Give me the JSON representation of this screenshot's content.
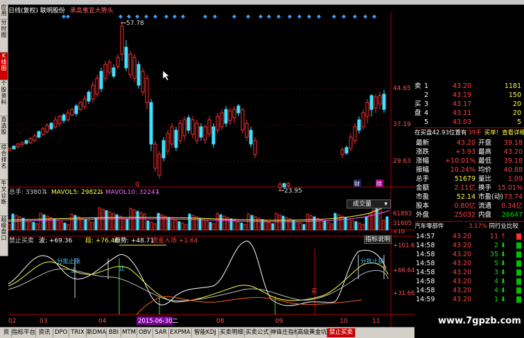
{
  "header": {
    "chart_label": "日线(复权)",
    "stock_name": "联明股份",
    "signal_text": "承高事宜大势头"
  },
  "side_tabs": [
    "应用",
    "分时图",
    "K线图",
    "个股资料",
    "自选股",
    "综合排名",
    "牛叉诊断",
    "超级盘口"
  ],
  "price_chart": {
    "price_axis": [
      "44.65",
      "37.19",
      "29.63"
    ],
    "high_label": "57.78",
    "low_label": "23.95",
    "marks": [
      "q",
      "财",
      "除"
    ],
    "up_color": "#ff3030",
    "down_color": "#40e0ff"
  },
  "volume_panel": {
    "total_hands_label": "总手: 33807",
    "mavol5_label": "MAVOL5: 29822",
    "mavol10_label": "MAVOL10: 32247",
    "selector": "成交量",
    "axis": [
      "61893",
      "31605"
    ],
    "axis_unit": "×10"
  },
  "indicator_panel": {
    "name": "禁止买卖",
    "wave": "波: +69.36",
    "segment": "段: +76.46",
    "trend": "趋势: +48.71",
    "fund": "资金入场 +1.64",
    "help": "指标说明",
    "axis": [
      "+101.6",
      "+66.64",
      "+31.66"
    ],
    "annotations": [
      "分批止涨",
      "止",
      "止",
      "分批止损",
      "买"
    ]
  },
  "x_axis": [
    "02",
    "03",
    "04",
    "2015-06-30二",
    "08",
    "09",
    "10",
    "11"
  ],
  "quote": {
    "order_book": [
      {
        "side": "卖",
        "level": "1",
        "price": "43.20",
        "vol": "1181"
      },
      {
        "side": "",
        "level": "2",
        "price": "43.19",
        "vol": "150"
      },
      {
        "side": "买",
        "level": "3",
        "price": "43.17",
        "vol": "20"
      },
      {
        "side": "盘",
        "level": "4",
        "price": "43.11",
        "vol": "20"
      },
      {
        "side": "",
        "level": "5",
        "price": "43.03",
        "vol": "5"
      }
    ],
    "bid_info": "在买盘42.93位置有",
    "bid_count": "39手",
    "bid_link": "买单！查看详细",
    "stats": [
      [
        "最新",
        "43.20",
        "开盘",
        "39.18"
      ],
      [
        "涨跌",
        "+3.93",
        "最高",
        "43.20"
      ],
      [
        "涨幅",
        "+10.01%",
        "最低",
        "39.18"
      ],
      [
        "振幅",
        "10.24%",
        "均价",
        "40.88"
      ],
      [
        "总手",
        "51679",
        "量比",
        "1.09"
      ],
      [
        "金额",
        "2.11亿",
        "换手",
        "15.01%"
      ],
      [
        "市盈",
        "52.14",
        "市盈(动)",
        "73.74"
      ],
      [
        "股本",
        "0.80亿",
        "流通",
        "0.34亿"
      ],
      [
        "外盘",
        "25032",
        "内盘",
        "26647"
      ]
    ],
    "industry": "汽车零部件",
    "industry_change": "3.17%",
    "industry_compare": "同行业比较",
    "ticks": [
      {
        "time": "14:57",
        "price": "43.20",
        "vol": "11",
        "dir": "up"
      },
      {
        "time": "14:58",
        "price": "43.20",
        "vol": "2",
        "dir": "down"
      },
      {
        "time": "14:58",
        "price": "43.20",
        "vol": "35",
        "dir": "down"
      },
      {
        "time": "14:58",
        "price": "43.20",
        "vol": "5",
        "dir": "down"
      },
      {
        "time": "14:58",
        "price": "43.20",
        "vol": "3",
        "dir": "down"
      },
      {
        "time": "14:58",
        "price": "43.20",
        "vol": "4",
        "dir": "down"
      },
      {
        "time": "14:58",
        "price": "43.20",
        "vol": "4",
        "dir": "down"
      },
      {
        "time": "14:59",
        "price": "43.20",
        "vol": "1",
        "dir": "down"
      }
    ]
  },
  "bottom_tabs": [
    "资",
    "指标平台",
    "资讯",
    "DPO",
    "TRIX",
    "新DMA",
    "BBI",
    "MTM",
    "OBV",
    "SAR",
    "EXPMA",
    "智能KDJ",
    "买卖明细",
    "买卖公式",
    "神锋庄指标",
    "高级黄金坑",
    "禁止买卖"
  ],
  "watermark": "www.7gpzb.com"
}
